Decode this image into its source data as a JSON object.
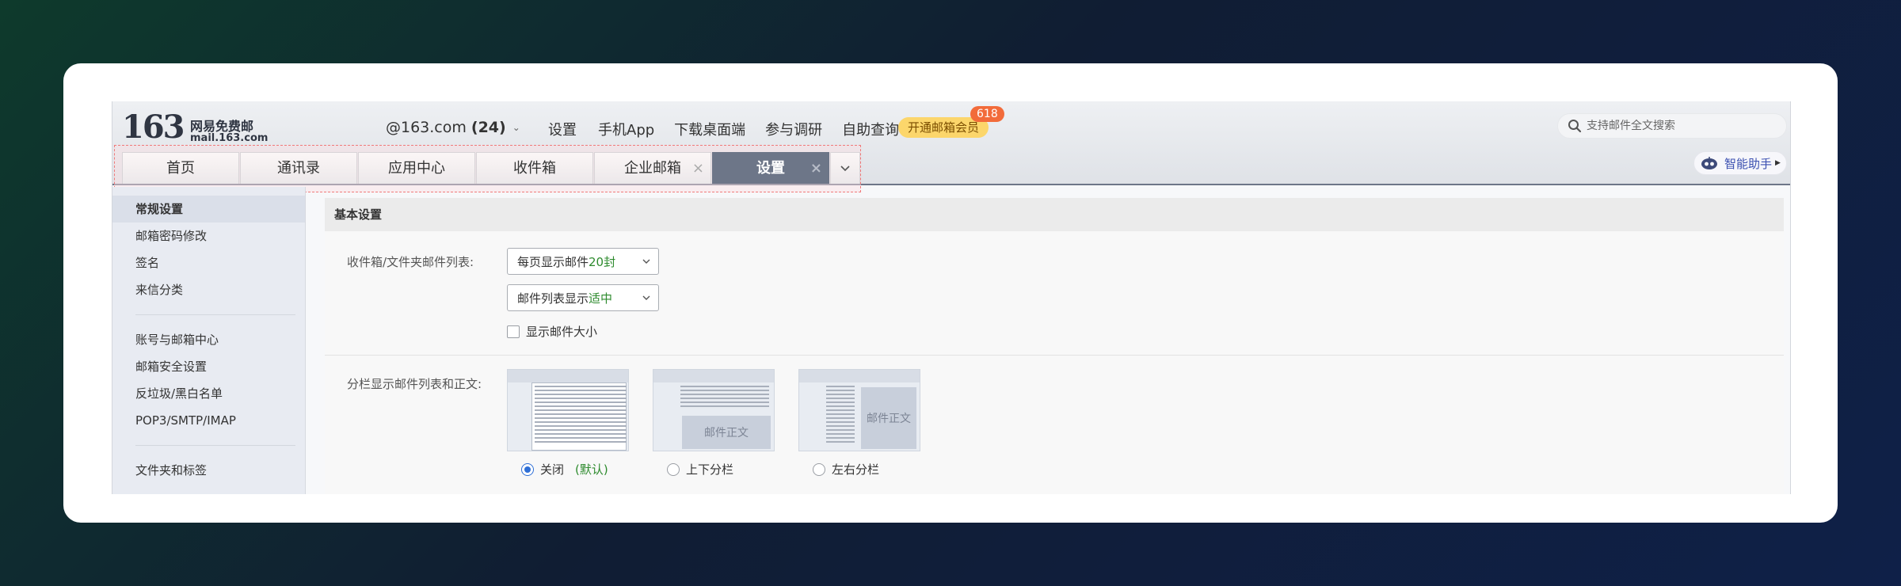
{
  "header": {
    "logo_number": "163",
    "logo_cn": "网易免费邮",
    "logo_url": "mail.163.com",
    "account": "@163.com",
    "unread_count": "(24)",
    "nav": [
      "设置",
      "手机App",
      "下载桌面端",
      "参与调研",
      "自助查询"
    ],
    "vip_label": "开通邮箱会员",
    "vip_badge": "618",
    "search_placeholder": "支持邮件全文搜索",
    "assistant_label": "智能助手"
  },
  "tabs": [
    {
      "label": "首页",
      "closable": false,
      "active": false
    },
    {
      "label": "通讯录",
      "closable": false,
      "active": false
    },
    {
      "label": "应用中心",
      "closable": false,
      "active": false
    },
    {
      "label": "收件箱",
      "closable": false,
      "active": false
    },
    {
      "label": "企业邮箱",
      "closable": true,
      "active": false
    },
    {
      "label": "设置",
      "closable": true,
      "active": true
    }
  ],
  "sidebar": {
    "group1": [
      "常规设置",
      "邮箱密码修改",
      "签名",
      "来信分类"
    ],
    "group2": [
      "账号与邮箱中心",
      "邮箱安全设置",
      "反垃圾/黑白名单",
      "POP3/SMTP/IMAP"
    ],
    "group3": [
      "文件夹和标签"
    ]
  },
  "main": {
    "section_title": "基本设置",
    "list_label": "收件箱/文件夹邮件列表:",
    "per_page_prefix": "每页显示邮件",
    "per_page_value": "20封",
    "density_prefix": "邮件列表显示",
    "density_value": "适中",
    "show_size_label": "显示邮件大小",
    "split_label": "分栏显示邮件列表和正文:",
    "layouts": [
      {
        "label": "关闭",
        "default_note": "(默认)",
        "selected": true
      },
      {
        "label": "上下分栏",
        "panel_text": "邮件正文",
        "selected": false
      },
      {
        "label": "左右分栏",
        "panel_text": "邮件正文",
        "selected": false
      }
    ]
  },
  "colors": {
    "active_tab": "#6d7688",
    "vip": "#fcd66b",
    "badge": "#f26b3a",
    "accent_green": "#2e8b2e",
    "radio_blue": "#2f6fd6"
  }
}
